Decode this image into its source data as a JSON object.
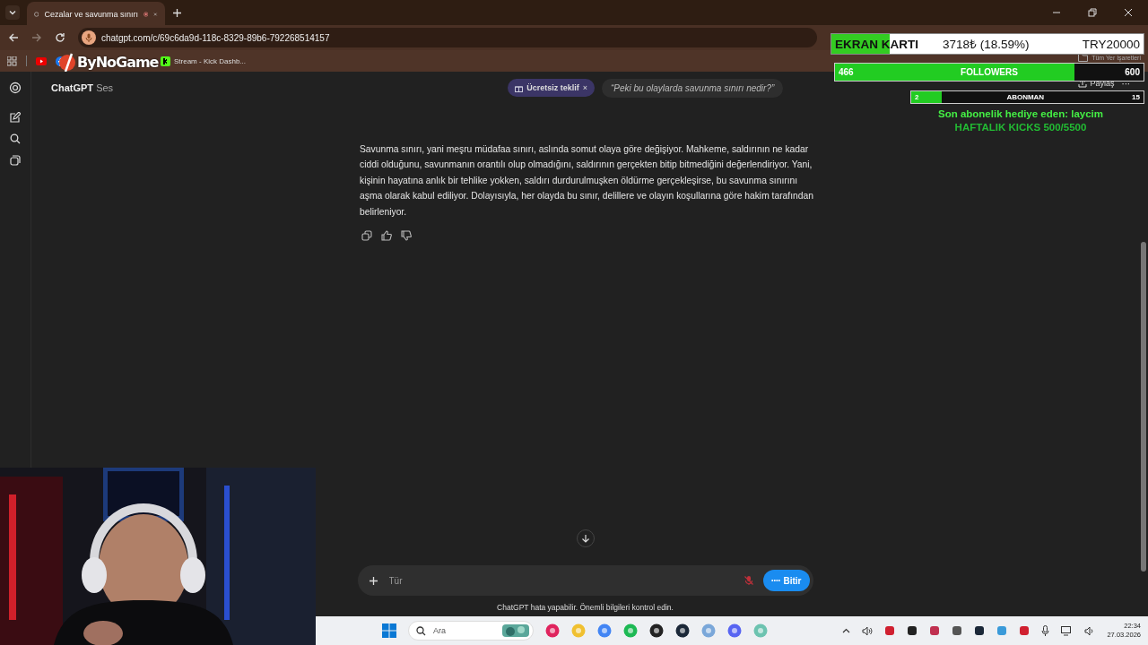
{
  "browser": {
    "tab_title": "Cezalar ve savunma sınırı",
    "url": "chatgpt.com/c/69c6da9d-118c-8329-89b6-792268514157",
    "bookmarks": [
      {
        "kind": "facebook"
      },
      {
        "label": "Stream - Kick Dashb...",
        "kind": "kick"
      }
    ],
    "all_bookmarks": "Tüm Yer İşaretleri"
  },
  "header": {
    "title": "ChatGPT",
    "subtitle": "Ses",
    "offer": "Ücretsiz teklif",
    "offer_close": "×",
    "suggestion": "“Peki bu olaylarda savunma sınırı nedir?”",
    "share": "Paylaş",
    "more": "···"
  },
  "message": {
    "text": "Savunma sınırı, yani meşru müdafaa sınırı, aslında somut olaya göre değişiyor. Mahkeme, saldırının ne kadar ciddi olduğunu, savunmanın orantılı olup olmadığını, saldırının gerçekten bitip bitmediğini değerlendiriyor. Yani, kişinin hayatına anlık bir tehlike yokken, saldırı durdurulmuşken öldürme gerçekleşirse, bu savunma sınırını aşma olarak kabul ediliyor. Dolayısıyla, her olayda bu sınır, delillere ve olayın koşullarına göre hakim tarafından belirleniyor."
  },
  "composer": {
    "placeholder": "Tür",
    "end_button": "Bitir",
    "mic_muted": true
  },
  "disclaimer": "ChatGPT hata yapabilir. Önemli bilgileri kontrol edin.",
  "overlay": {
    "logo": "ByNoGame",
    "goal": {
      "label": "EKRAN KARTI",
      "amount": "3718₺ (18.59%)",
      "target": "TRY20000",
      "level": 0.1859
    },
    "followers": {
      "current": "466",
      "label": "FOLLOWERS",
      "target": "600",
      "level": 0.777
    },
    "subs": {
      "current": "2",
      "label": "ABONMAN",
      "target": "15",
      "level": 0.133
    },
    "last_gift": "Son abonelik hediye eden: laycim",
    "weekly": "HAFTALIK KICKS 500/5500"
  },
  "taskbar": {
    "search": "Ara",
    "time": "22:34",
    "date": "27.03.2026"
  }
}
